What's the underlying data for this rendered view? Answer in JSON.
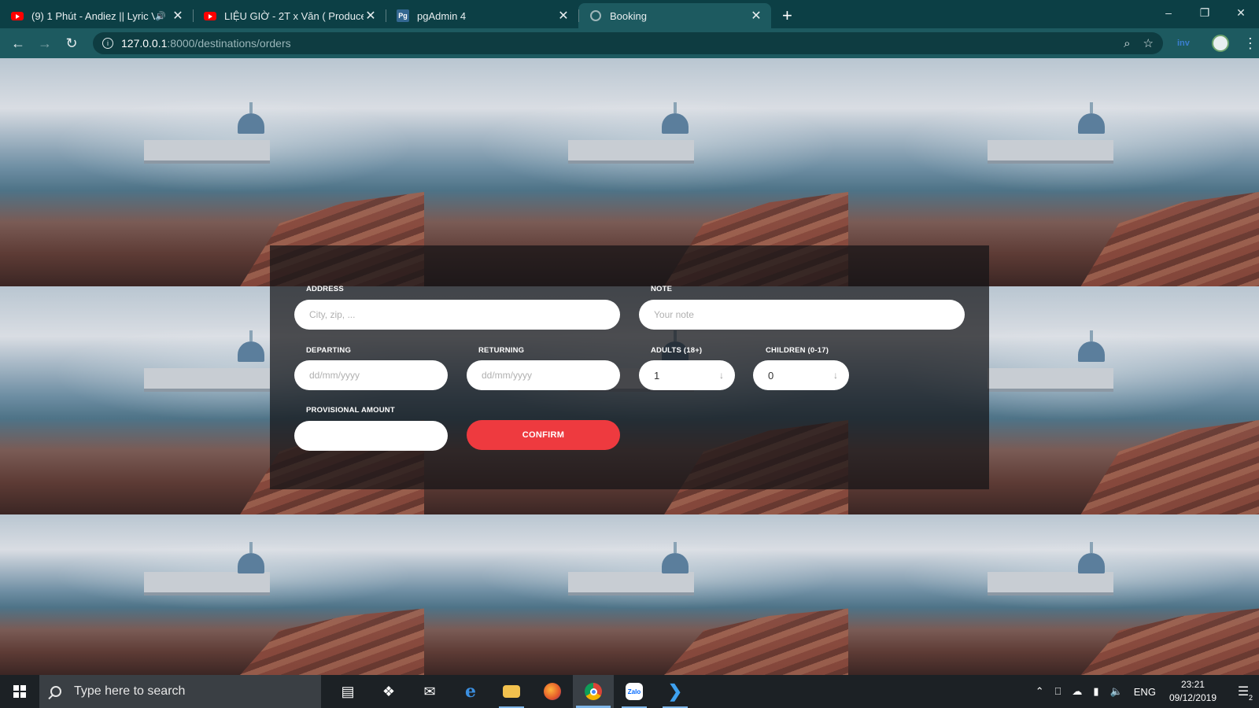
{
  "browser": {
    "tabs": [
      {
        "title": "(9) 1 Phút - Andiez || Lyric Vi",
        "icon": "youtube-icon",
        "audio": true,
        "active": false
      },
      {
        "title": "LIỆU GIỜ - 2T x Văn ( Produced b",
        "icon": "youtube-icon",
        "audio": false,
        "active": false
      },
      {
        "title": "pgAdmin 4",
        "icon": "pgadmin-icon",
        "audio": false,
        "active": false
      },
      {
        "title": "Booking",
        "icon": "globe-icon",
        "audio": false,
        "active": true
      }
    ],
    "pgadmin_favicon_text": "Pg",
    "extension_label": "inv",
    "address": {
      "host": "127.0.0.1",
      "path": ":8000/destinations/orders"
    }
  },
  "form": {
    "address": {
      "label": "ADDRESS",
      "placeholder": "City, zip, ..."
    },
    "note": {
      "label": "NOTE",
      "placeholder": "Your note"
    },
    "departing": {
      "label": "DEPARTING",
      "placeholder": "dd/mm/yyyy"
    },
    "returning": {
      "label": "RETURNING",
      "placeholder": "dd/mm/yyyy"
    },
    "adults": {
      "label": "ADULTS (18+)",
      "value": "1"
    },
    "children": {
      "label": "CHILDREN (0-17)",
      "value": "0"
    },
    "provisional_amount": {
      "label": "PROVISIONAL AMOUNT",
      "value": ""
    },
    "confirm_label": "CONFIRM"
  },
  "taskbar": {
    "search_placeholder": "Type here to search",
    "zalo_label": "Zalo",
    "language": "ENG",
    "time": "23:21",
    "date": "09/12/2019",
    "notification_count": "2"
  },
  "colors": {
    "accent": "#ee3a3f",
    "chrome_dark": "#0c3f45",
    "chrome_toolbar": "#1d5a60"
  }
}
